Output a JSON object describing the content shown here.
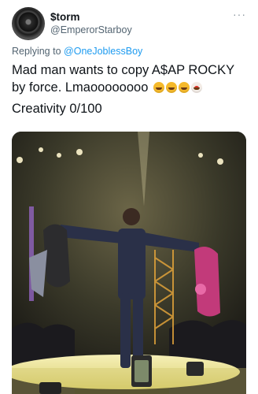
{
  "tweet": {
    "display_name": "$torm",
    "handle": "@EmperorStarboy",
    "more_label": "···",
    "reply_prefix": "Replying to",
    "reply_to": "@OneJoblessBoy",
    "text_line1": "Mad man wants to copy A$AP ROCKY",
    "text_line2": "by force. Lmaoooooooo",
    "emojis": [
      "rofl-emoji",
      "rofl-emoji",
      "rofl-emoji",
      "clown-emoji"
    ],
    "text_line3": "Creativity 0/100"
  },
  "media": {
    "type": "photo",
    "description_icon": "photo",
    "colors": {
      "stage_glow": "#f4e3a0",
      "outfit": "#2a3048",
      "crowd": "#1b1a1e"
    }
  }
}
